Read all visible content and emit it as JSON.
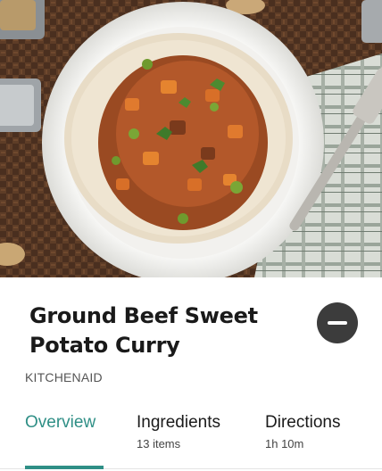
{
  "recipe": {
    "title_line1": "Ground Beef Sweet",
    "title_line2": "Potato Curry",
    "source": "KITCHENAID"
  },
  "tabs": [
    {
      "label": "Overview",
      "sub": "",
      "active": true
    },
    {
      "label": "Ingredients",
      "sub": "13 items",
      "active": false
    },
    {
      "label": "Directions",
      "sub": "1h 10m",
      "active": false
    }
  ],
  "colors": {
    "accent": "#2f8f86",
    "remove_button": "#3c3c3c"
  }
}
